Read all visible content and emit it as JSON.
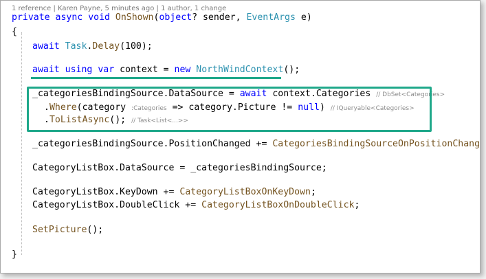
{
  "codelens": "1 reference | Karen Payne, 5 minutes ago | 1 author, 1 change",
  "code": {
    "signature": {
      "private": "private",
      "async": "async",
      "void": "void",
      "method": "OnShown",
      "open_paren": "(",
      "object": "object",
      "sender": "? sender, ",
      "event_args": "EventArgs",
      "e": " e)"
    },
    "open_brace": "{",
    "close_brace": "}",
    "line_delay": {
      "await": "await",
      "task": "Task",
      "dot": ".",
      "delay": "Delay",
      "rest": "(100);"
    },
    "line_context": {
      "await": "await",
      "using": "using",
      "var": "var",
      "context": "context = ",
      "new": "new",
      "northwind": "NorthWindContext",
      "rest": "();"
    },
    "line_datasource": {
      "prefix": "_categoriesBindingSource.DataSource = ",
      "await": "await",
      "rest": " context.Categories",
      "hint": "// DbSet<Categories>"
    },
    "line_where": {
      "dot": ".",
      "where": "Where",
      "open": "(category",
      "param_hint": ":Categories",
      "rest": " => category.Picture != ",
      "null": "null",
      "close": ")",
      "hint": "// IQueryable<Categories>"
    },
    "line_tolist": {
      "dot": ".",
      "method": "ToListAsync",
      "rest": "();",
      "hint": "// Task<List<...>>"
    },
    "line_position": {
      "prefix": "_categoriesBindingSource.PositionChanged += ",
      "handler": "CategoriesBindingSourceOnPositionChanged",
      "rest": ";"
    },
    "line_listbox_ds": "CategoryListBox.DataSource = _categoriesBindingSource;",
    "line_keydown": {
      "prefix": "CategoryListBox.KeyDown += ",
      "handler": "CategoryListBoxOnKeyDown",
      "rest": ";"
    },
    "line_doubleclick": {
      "prefix": "CategoryListBox.DoubleClick += ",
      "handler": "CategoryListBoxOnDoubleClick",
      "rest": ";"
    },
    "line_setpicture": {
      "method": "SetPicture",
      "rest": "();"
    }
  },
  "colors": {
    "keyword": "#0000ff",
    "type": "#2b91af",
    "method": "#74531f",
    "hint": "#8c8c8c",
    "annotation": "#1fa88a"
  }
}
